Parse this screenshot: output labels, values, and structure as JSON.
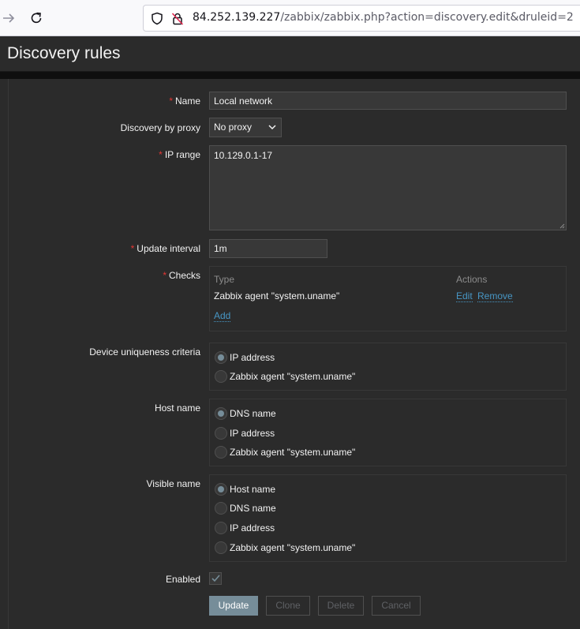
{
  "browser": {
    "url_host": "84.252.139.227",
    "url_path": "/zabbix/zabbix.php?action=discovery.edit&druleid=2"
  },
  "page": {
    "title": "Discovery rules"
  },
  "form": {
    "required_mark": "*",
    "name": {
      "label": "Name",
      "value": "Local network"
    },
    "proxy": {
      "label": "Discovery by proxy",
      "value": "No proxy"
    },
    "ip_range": {
      "label": "IP range",
      "value": "10.129.0.1-17"
    },
    "update_interval": {
      "label": "Update interval",
      "value": "1m"
    },
    "checks": {
      "label": "Checks",
      "col_type": "Type",
      "col_actions": "Actions",
      "rows": [
        {
          "type": "Zabbix agent \"system.uname\"",
          "edit": "Edit",
          "remove": "Remove"
        }
      ],
      "add": "Add"
    },
    "uniqueness": {
      "label": "Device uniqueness criteria",
      "options": [
        "IP address",
        "Zabbix agent \"system.uname\""
      ],
      "selected": "IP address"
    },
    "host_name": {
      "label": "Host name",
      "options": [
        "DNS name",
        "IP address",
        "Zabbix agent \"system.uname\""
      ],
      "selected": "DNS name"
    },
    "visible_name": {
      "label": "Visible name",
      "options": [
        "Host name",
        "DNS name",
        "IP address",
        "Zabbix agent \"system.uname\""
      ],
      "selected": "Host name"
    },
    "enabled": {
      "label": "Enabled",
      "checked": true
    }
  },
  "buttons": {
    "update": "Update",
    "clone": "Clone",
    "delete": "Delete",
    "cancel": "Cancel"
  },
  "colors": {
    "accent": "#768d99",
    "link": "#4796c4",
    "required": "#e33734",
    "background": "#2b2b2b"
  },
  "icons": [
    "arrow-forward-icon",
    "reload-icon",
    "shield-icon",
    "lock-icon",
    "chevron-down-icon",
    "checkmark-icon"
  ]
}
